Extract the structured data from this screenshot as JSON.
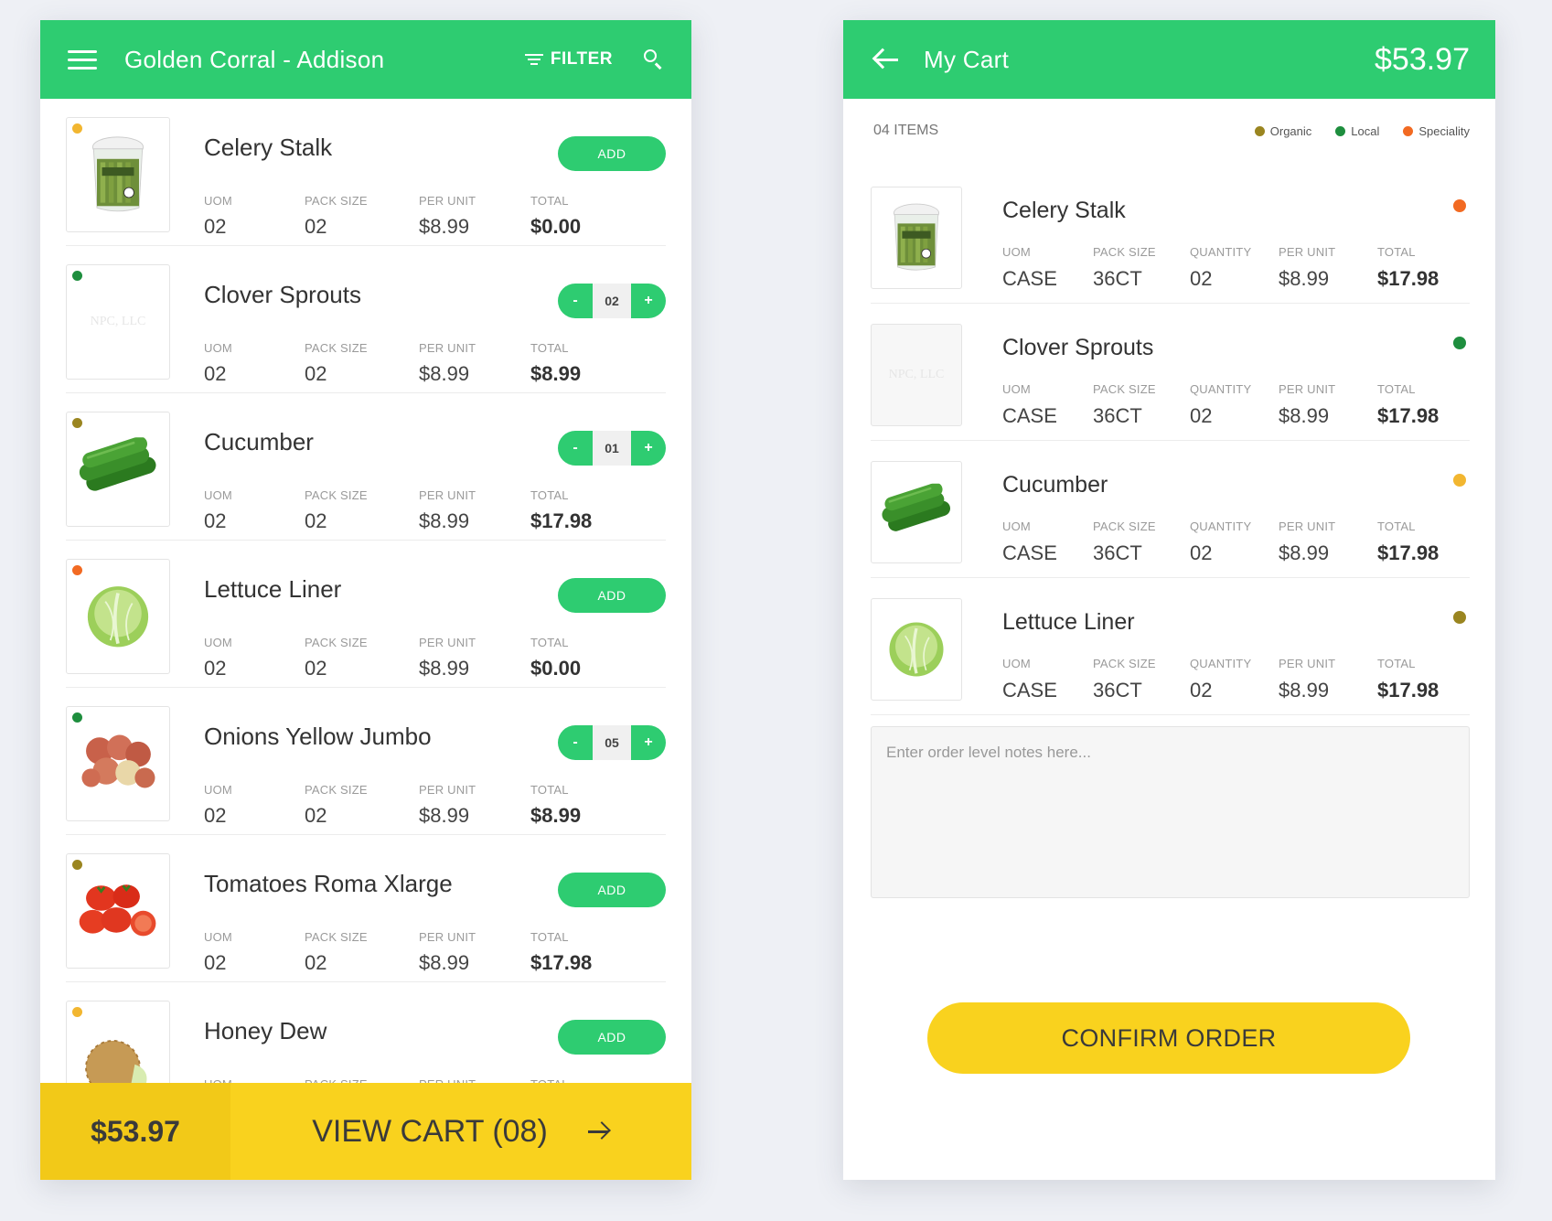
{
  "colors": {
    "brand_green": "#2ecc71",
    "accent_yellow": "#f9d21e",
    "organic": "#9a8520",
    "local": "#1e8e3e",
    "speciality": "#f26a22",
    "yellow_tag": "#f2b630"
  },
  "left": {
    "header": {
      "title": "Golden Corral - Addison",
      "filter_label": "FILTER",
      "menu_icon": "hamburger-icon",
      "search_icon": "search-icon"
    },
    "products": [
      {
        "name": "Celery Stalk",
        "dot": "#f2b630",
        "image": "celery",
        "uom": "02",
        "pack_size": "02",
        "per_unit": "$8.99",
        "total": "$0.00",
        "control": "add",
        "add_label": "ADD"
      },
      {
        "name": "Clover Sprouts",
        "dot": "#1e8e3e",
        "image": "npc",
        "uom": "02",
        "pack_size": "02",
        "per_unit": "$8.99",
        "total": "$8.99",
        "control": "stepper",
        "qty": "02",
        "minus_label": "-",
        "plus_label": "+"
      },
      {
        "name": "Cucumber",
        "dot": "#9a8520",
        "image": "cucumber",
        "uom": "02",
        "pack_size": "02",
        "per_unit": "$8.99",
        "total": "$17.98",
        "control": "stepper",
        "qty": "01",
        "minus_label": "-",
        "plus_label": "+"
      },
      {
        "name": "Lettuce Liner",
        "dot": "#f26a22",
        "image": "lettuce",
        "uom": "02",
        "pack_size": "02",
        "per_unit": "$8.99",
        "total": "$0.00",
        "control": "add",
        "add_label": "ADD"
      },
      {
        "name": "Onions Yellow Jumbo",
        "dot": "#1e8e3e",
        "image": "onions",
        "uom": "02",
        "pack_size": "02",
        "per_unit": "$8.99",
        "total": "$8.99",
        "control": "stepper",
        "qty": "05",
        "minus_label": "-",
        "plus_label": "+"
      },
      {
        "name": "Tomatoes Roma Xlarge",
        "dot": "#9a8520",
        "image": "tomatoes",
        "uom": "02",
        "pack_size": "02",
        "per_unit": "$8.99",
        "total": "$17.98",
        "control": "add",
        "add_label": "ADD"
      },
      {
        "name": "Honey Dew",
        "dot": "#f2b630",
        "image": "honeydew",
        "uom": "",
        "pack_size": "",
        "per_unit": "",
        "total": "",
        "control": "add",
        "add_label": "ADD"
      }
    ],
    "labels": {
      "uom": "UOM",
      "pack_size": "PACK SIZE",
      "per_unit": "PER UNIT",
      "total": "TOTAL"
    },
    "cart_bar": {
      "total": "$53.97",
      "view_cart_label": "VIEW CART (08)"
    }
  },
  "right": {
    "header": {
      "title": "My Cart",
      "total": "$53.97"
    },
    "item_count": "04 ITEMS",
    "legend": [
      {
        "label": "Organic",
        "color": "#9a8520"
      },
      {
        "label": "Local",
        "color": "#1e8e3e"
      },
      {
        "label": "Speciality",
        "color": "#f26a22"
      }
    ],
    "labels": {
      "uom": "UOM",
      "pack_size": "PACK SIZE",
      "quantity": "QUANTITY",
      "per_unit": "PER UNIT",
      "total": "TOTAL"
    },
    "items": [
      {
        "name": "Celery Stalk",
        "dot": "#f26a22",
        "image": "celery",
        "uom": "CASE",
        "pack_size": "36CT",
        "quantity": "02",
        "per_unit": "$8.99",
        "total": "$17.98"
      },
      {
        "name": "Clover Sprouts",
        "dot": "#1e8e3e",
        "image": "npc",
        "uom": "CASE",
        "pack_size": "36CT",
        "quantity": "02",
        "per_unit": "$8.99",
        "total": "$17.98"
      },
      {
        "name": "Cucumber",
        "dot": "#f2b630",
        "image": "cucumber",
        "uom": "CASE",
        "pack_size": "36CT",
        "quantity": "02",
        "per_unit": "$8.99",
        "total": "$17.98"
      },
      {
        "name": "Lettuce Liner",
        "dot": "#9a8520",
        "image": "lettuce",
        "uom": "CASE",
        "pack_size": "36CT",
        "quantity": "02",
        "per_unit": "$8.99",
        "total": "$17.98"
      }
    ],
    "notes_placeholder": "Enter order level notes here...",
    "confirm_label": "CONFIRM ORDER"
  },
  "npc_text": "NPC, LLC"
}
